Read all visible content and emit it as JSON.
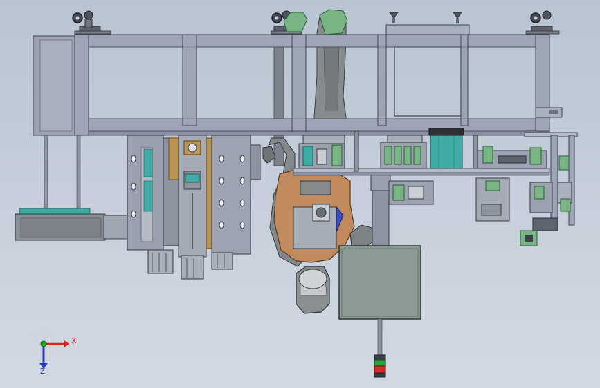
{
  "viewport": {
    "background_top": "#b9c4d2",
    "background_bottom": "#d2d9e3"
  },
  "colors": {
    "frame": "#9ea5b7",
    "frame_edge": "#3e4250",
    "panel_gray": "#8e949f",
    "robot_gray": "#868c8e",
    "robot_tan": "#c08a5c",
    "control_box": "#8b9a94",
    "green_part": "#79b584",
    "teal_part": "#3eaca4",
    "brass_part": "#b99452",
    "signal_red": "#d72a2a",
    "signal_green": "#29a43c",
    "axis_x": "#e02020",
    "axis_y": "#2aa030",
    "axis_z": "#2a3cc0"
  },
  "triad": {
    "x_label": "X",
    "z_label": "Z"
  }
}
